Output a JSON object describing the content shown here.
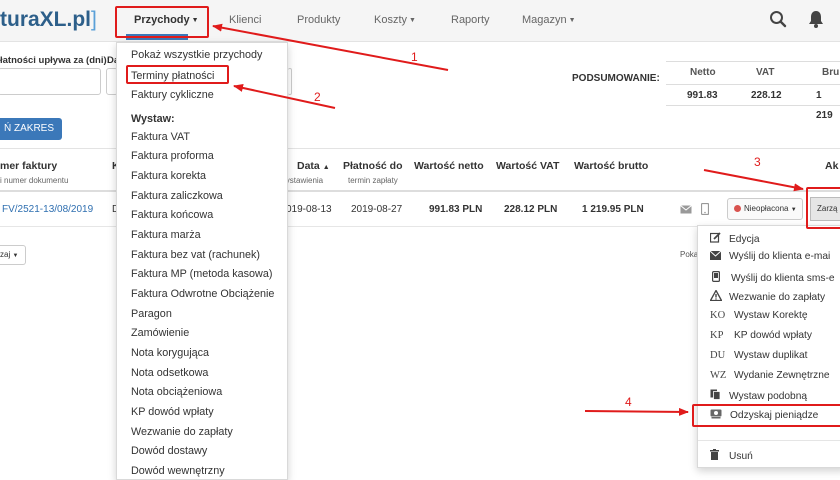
{
  "topnav": {
    "logo_text": "turaXL.pl",
    "logo_bracket": "]",
    "items": [
      {
        "label": "Przychody"
      },
      {
        "label": "Klienci"
      },
      {
        "label": "Produkty"
      },
      {
        "label": "Koszty"
      },
      {
        "label": "Raporty"
      },
      {
        "label": "Magazyn"
      }
    ],
    "search_icon": "search-icon",
    "bell_icon": "bell-icon"
  },
  "filter": {
    "due_label": "łatności upływa za (dni):",
    "next_label": "Da",
    "zakres_button": "Ń ZAKRES"
  },
  "summary": {
    "label": "PODSUMOWANIE:",
    "headers": [
      "Netto",
      "VAT",
      "Bru"
    ],
    "values": [
      "991.83",
      "228.12",
      "1 219"
    ]
  },
  "table": {
    "headers": {
      "number": "mer faktury",
      "number_sub": "i numer dokumentu",
      "kind": "K",
      "date": "Data",
      "date_sub": "wystawienia",
      "payment": "Płatność do",
      "payment_sub": "termin zapłaty",
      "net": "Wartość netto",
      "vat": "Wartość VAT",
      "gross": "Wartość brutto",
      "actions": "Ak"
    },
    "row": {
      "number": "FV/2521-13/08/2019",
      "kind": "D",
      "date": "019-08-13",
      "payment": "2019-08-27",
      "net": "991.83 PLN",
      "vat": "228.12 PLN",
      "gross": "1 219.95 PLN",
      "status": "Nieopłacona",
      "manage": "Zarzą"
    },
    "small_button": "zaj",
    "pokaz": "Poka"
  },
  "dropdown": {
    "items_top": [
      "Pokaż wszystkie przychody",
      "Terminy płatności",
      "Faktury cykliczne"
    ],
    "section": "Wystaw:",
    "items": [
      "Faktura VAT",
      "Faktura proforma",
      "Faktura korekta",
      "Faktura zaliczkowa",
      "Faktura końcowa",
      "Faktura marża",
      "Faktura bez vat (rachunek)",
      "Faktura MP (metoda kasowa)",
      "Faktura Odwrotne Obciążenie",
      "Paragon",
      "Zamówienie",
      "Nota korygująca",
      "Nota odsetkowa",
      "Nota obciążeniowa",
      "KP dowód wpłaty",
      "Wezwanie do zapłaty",
      "Dowód dostawy",
      "Dowód wewnętrzny"
    ]
  },
  "actions_menu": {
    "items": [
      {
        "icon": "edit-icon",
        "label": "Edycja"
      },
      {
        "icon": "envelope-icon",
        "label": "Wyślij do klienta e-mai"
      },
      {
        "icon": "mobile-icon",
        "label": "Wyślij do klienta sms-e"
      },
      {
        "icon": "warning-icon",
        "label": "Wezwanie do zapłaty"
      },
      {
        "icon_text": "KO",
        "label": "Wystaw Korektę"
      },
      {
        "icon_text": "KP",
        "label": "KP dowód wpłaty"
      },
      {
        "icon_text": "DU",
        "label": "Wystaw duplikat"
      },
      {
        "icon_text": "WZ",
        "label": "Wydanie Zewnętrzne"
      },
      {
        "icon": "copy-icon",
        "label": "Wystaw podobną"
      },
      {
        "icon": "money-icon",
        "label": "Odzyskaj pieniądze"
      },
      {
        "icon": "trash-icon",
        "label": "Usuń"
      }
    ]
  },
  "annotations": {
    "numbers": [
      "1",
      "2",
      "3",
      "4"
    ],
    "color": "#e01b1b"
  },
  "colors": {
    "accent": "#3b78b9",
    "link": "#2f6fb0",
    "status_unpaid": "#d9534f"
  }
}
